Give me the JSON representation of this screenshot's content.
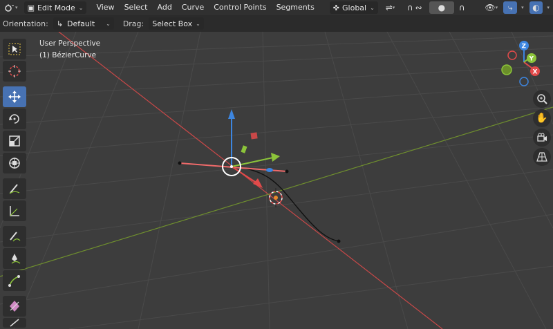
{
  "header": {
    "mode_dropdown": "Edit Mode",
    "menus": [
      "View",
      "Select",
      "Add",
      "Curve",
      "Control Points",
      "Segments"
    ],
    "transform_orientation": "Global"
  },
  "tool_settings": {
    "orientation_label": "Orientation:",
    "orientation_value": "Default",
    "drag_label": "Drag:",
    "drag_value": "Select Box"
  },
  "viewport": {
    "view_name": "User Perspective",
    "object_name": "(1) BézierCurve"
  },
  "nav_gizmo": {
    "x_label": "X",
    "y_label": "Y",
    "z_label": "Z"
  },
  "toolbar": {
    "tools": [
      "select-box",
      "cursor",
      "move",
      "rotate",
      "scale",
      "transform",
      "annotate",
      "measure",
      "draw",
      "pen",
      "curve-extrude",
      "radius"
    ],
    "active_tool": "move"
  },
  "colors": {
    "x_axis": "#e24a4a",
    "y_axis": "#8cc43a",
    "z_axis": "#3d86e0",
    "active_blue": "#4772b3",
    "grid_background": "#3d3d3d"
  }
}
